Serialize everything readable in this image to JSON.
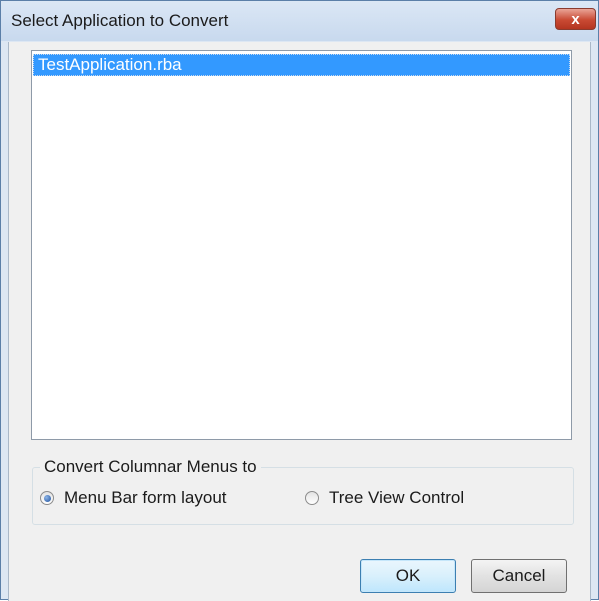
{
  "window": {
    "title": "Select Application to Convert",
    "close_glyph": "x"
  },
  "application_list": {
    "items": [
      "TestApplication.rba"
    ],
    "selected_index": 0
  },
  "convert_group": {
    "label": "Convert Columnar Menus to",
    "options": [
      {
        "label": "Menu Bar form layout",
        "selected": true
      },
      {
        "label": "Tree View Control",
        "selected": false
      }
    ]
  },
  "buttons": {
    "ok_label": "OK",
    "cancel_label": "Cancel"
  },
  "colors": {
    "selection": "#3399ff",
    "close_button": "#c94a33",
    "window_frame": "#dde7f3"
  },
  "icons": {
    "close": "close-icon",
    "radio_selected": "radio-selected-icon",
    "radio_unselected": "radio-unselected-icon"
  }
}
